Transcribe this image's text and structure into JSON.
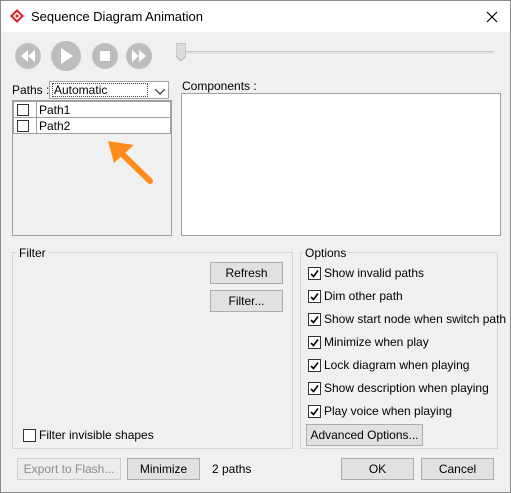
{
  "window": {
    "title": "Sequence Diagram Animation",
    "icon": "diamond-app-icon",
    "close_icon": "close-icon"
  },
  "playback": {
    "buttons": [
      {
        "name": "rewind-button",
        "icon": "rewind-icon"
      },
      {
        "name": "play-button",
        "icon": "play-icon"
      },
      {
        "name": "stop-button",
        "icon": "stop-icon"
      },
      {
        "name": "fast-forward-button",
        "icon": "fast-forward-icon"
      }
    ],
    "progress": 0
  },
  "paths": {
    "label": "Paths :",
    "mode_value": "Automatic",
    "items": [
      {
        "label": "Path1",
        "checked": false
      },
      {
        "label": "Path2",
        "checked": false
      }
    ]
  },
  "components": {
    "label": "Components :"
  },
  "filter": {
    "title": "Filter",
    "refresh_label": "Refresh",
    "filter_label": "Filter...",
    "invisible_shapes_label": "Filter invisible shapes",
    "invisible_shapes_checked": false
  },
  "options": {
    "title": "Options",
    "items": [
      {
        "label": "Show invalid paths",
        "checked": true
      },
      {
        "label": "Dim other path",
        "checked": true
      },
      {
        "label": "Show start node when switch path",
        "checked": true
      },
      {
        "label": "Minimize when play",
        "checked": true
      },
      {
        "label": "Lock diagram when playing",
        "checked": true
      },
      {
        "label": "Show description when playing",
        "checked": true
      },
      {
        "label": "Play voice when playing",
        "checked": true
      }
    ],
    "advanced_label": "Advanced Options..."
  },
  "footer": {
    "export_label": "Export to Flash...",
    "minimize_label": "Minimize",
    "path_count": "2 paths",
    "ok_label": "OK",
    "cancel_label": "Cancel"
  },
  "colors": {
    "accent_arrow": "#ff8c1a",
    "brand_icon": "#d9262c",
    "media_button": "#bdbdbd"
  }
}
